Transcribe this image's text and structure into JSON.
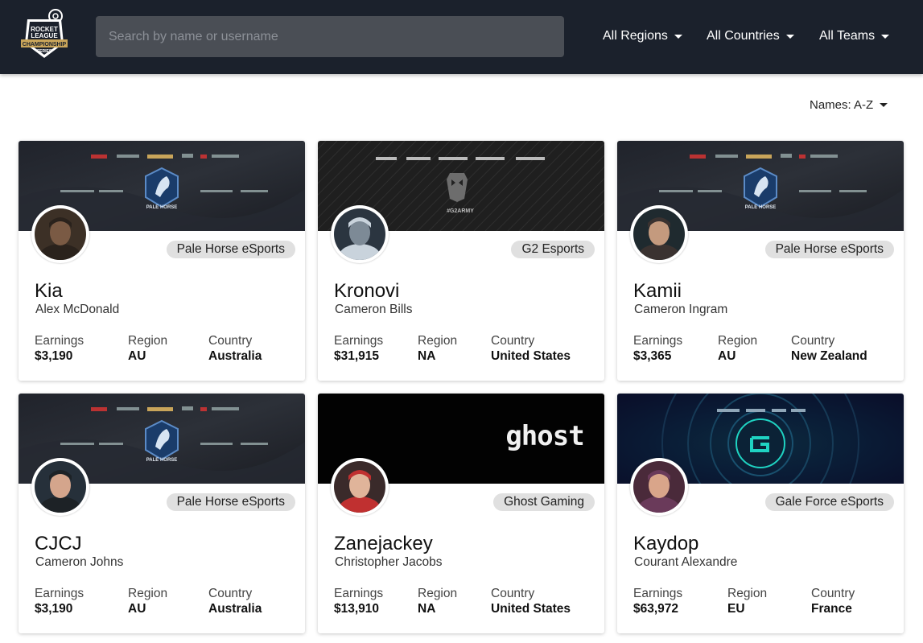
{
  "header": {
    "logo_text": [
      "ROCKET",
      "LEAGUE",
      "CHAMPIONSHIP",
      "SERIES"
    ],
    "search_placeholder": "Search by name or username",
    "filters": [
      {
        "label": "All Regions"
      },
      {
        "label": "All Countries"
      },
      {
        "label": "All Teams"
      }
    ]
  },
  "sort": {
    "label": "Names: A-Z"
  },
  "stat_labels": {
    "earnings": "Earnings",
    "region": "Region",
    "country": "Country"
  },
  "players": [
    {
      "gamertag": "Kia",
      "name": "Alex McDonald",
      "team": "Pale Horse eSports",
      "earnings": "$3,190",
      "region": "AU",
      "country": "Australia",
      "banner": "pale-horse"
    },
    {
      "gamertag": "Kronovi",
      "name": "Cameron Bills",
      "team": "G2 Esports",
      "earnings": "$31,915",
      "region": "NA",
      "country": "United States",
      "banner": "g2"
    },
    {
      "gamertag": "Kamii",
      "name": "Cameron Ingram",
      "team": "Pale Horse eSports",
      "earnings": "$3,365",
      "region": "AU",
      "country": "New Zealand",
      "banner": "pale-horse"
    },
    {
      "gamertag": "CJCJ",
      "name": "Cameron Johns",
      "team": "Pale Horse eSports",
      "earnings": "$3,190",
      "region": "AU",
      "country": "Australia",
      "banner": "pale-horse"
    },
    {
      "gamertag": "Zanejackey",
      "name": "Christopher Jacobs",
      "team": "Ghost Gaming",
      "earnings": "$13,910",
      "region": "NA",
      "country": "United States",
      "banner": "ghost"
    },
    {
      "gamertag": "Kaydop",
      "name": "Courant Alexandre",
      "team": "Gale Force eSports",
      "earnings": "$63,972",
      "region": "EU",
      "country": "France",
      "banner": "gale-force"
    }
  ],
  "banner_text": {
    "pale_horse": [
      "PALE HORSE"
    ],
    "g2": [
      "#G2ARMY"
    ],
    "ghost": [
      "ghost"
    ]
  },
  "colors": {
    "navbar": "#1b212c",
    "search_bg": "#4a4e55",
    "chip_bg": "#e0e0e0",
    "gold": "#c9a55a"
  }
}
